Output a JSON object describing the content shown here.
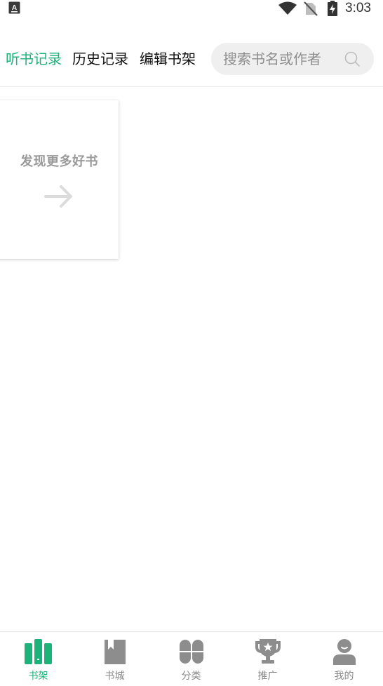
{
  "status_bar": {
    "time": "3:03",
    "app_icon_letter": "A",
    "icons": [
      "app-notification-icon",
      "wifi-icon",
      "no-sim-icon",
      "battery-charging-icon"
    ]
  },
  "header": {
    "tabs": [
      {
        "label": "听书记录",
        "active": true
      },
      {
        "label": "历史记录",
        "active": false
      },
      {
        "label": "编辑书架",
        "active": false
      }
    ],
    "search": {
      "placeholder": "搜索书名或作者",
      "icon": "search-icon"
    }
  },
  "shelf": {
    "discover_card": {
      "label": "发现更多好书",
      "icon": "arrow-right-icon"
    }
  },
  "bottom_nav": {
    "items": [
      {
        "label": "书架",
        "icon": "bookshelf-icon",
        "active": true
      },
      {
        "label": "书城",
        "icon": "bookstore-icon",
        "active": false
      },
      {
        "label": "分类",
        "icon": "category-icon",
        "active": false
      },
      {
        "label": "推广",
        "icon": "trophy-icon",
        "active": false
      },
      {
        "label": "我的",
        "icon": "profile-icon",
        "active": false
      }
    ]
  },
  "colors": {
    "accent": "#1bb37a",
    "inactive": "#888888",
    "search_bg": "#efefef"
  }
}
